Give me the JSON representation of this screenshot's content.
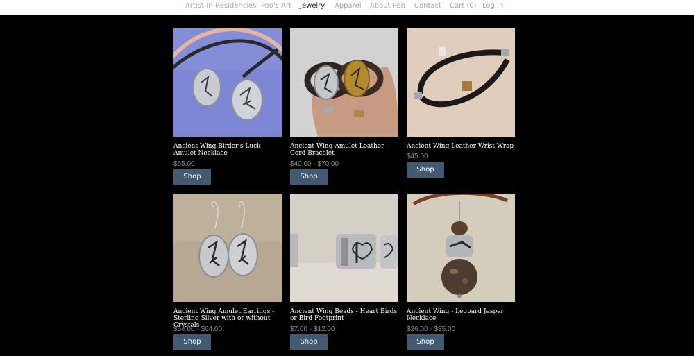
{
  "nav": {
    "items": [
      {
        "label": "Artist-In-Residencies"
      },
      {
        "label": "Poo's Art"
      },
      {
        "label": "Jewelry"
      },
      {
        "label": "Apparel"
      },
      {
        "label": "About Poo"
      },
      {
        "label": "Contact"
      },
      {
        "label": "Cart (0)"
      },
      {
        "label": "Log In"
      }
    ],
    "active": "Jewelry"
  },
  "products": [
    {
      "title": "Ancient Wing Birder's Luck Amulet Necklace",
      "price": "$55.00",
      "button": "Shop"
    },
    {
      "title": "Ancient Wing Amulet Leather Cord Bracelet",
      "price": "$40.00 - $70.00",
      "button": "Shop"
    },
    {
      "title": "Ancient Wing Leather Wrist Wrap",
      "price": "$45.00",
      "button": "Shop"
    },
    {
      "title": "Ancient Wing Amulet Earrings - Sterling Silver with or without Crystals",
      "price": "$54.00 - $64.00",
      "button": "Shop"
    },
    {
      "title": "Ancient Wing Beads - Heart Birds or Bird Footprint",
      "price": "$7.00 - $12.00",
      "button": "Shop"
    },
    {
      "title": "Ancient Wing - Leopard Jasper Necklace",
      "price": "$26.00 - $35.00",
      "button": "Shop"
    }
  ],
  "colors": {
    "background": "#000000",
    "nav_background": "#ffffff",
    "nav_text": "#a6a6a6",
    "nav_active": "#222222",
    "button": "#435a73",
    "title_text": "#ffffff",
    "price_text": "#8a8a8a"
  }
}
